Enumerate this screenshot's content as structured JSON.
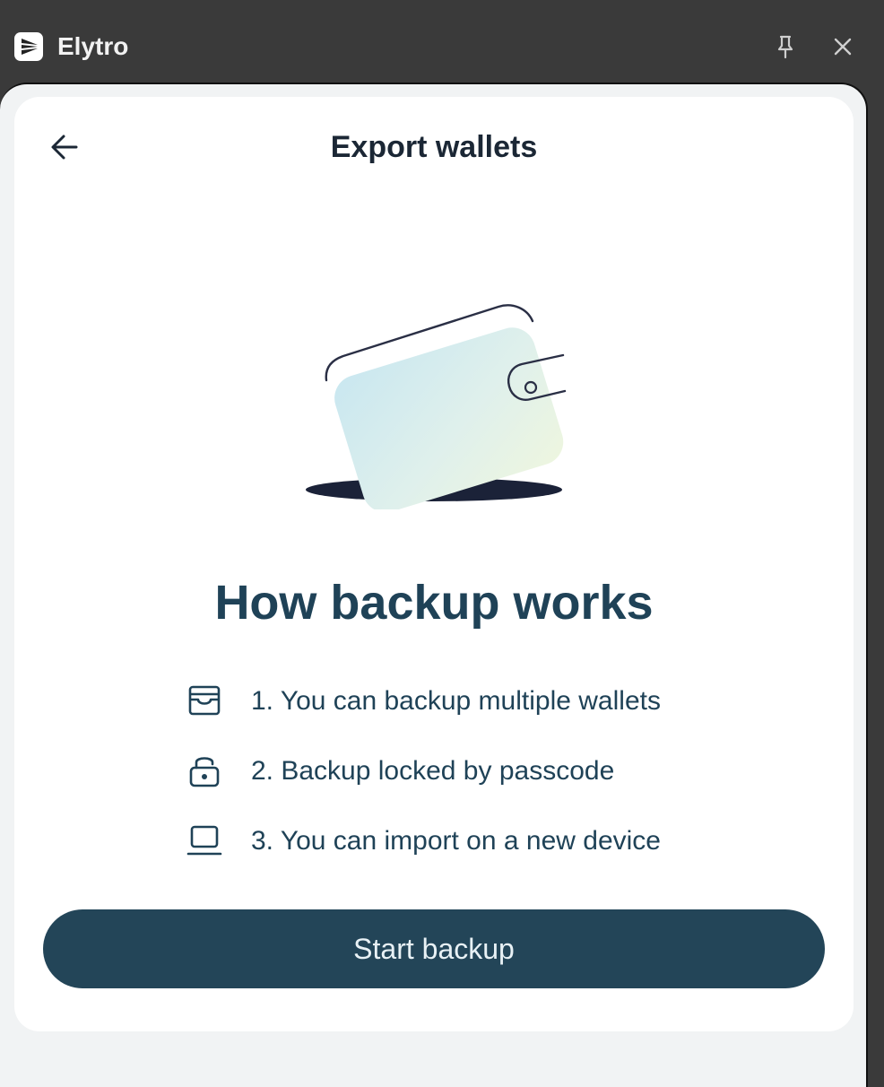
{
  "window": {
    "app_name": "Elytro",
    "logo_icon": "elytro-logo-icon",
    "pin_icon": "pin-icon",
    "close_icon": "close-icon"
  },
  "header": {
    "back_icon": "arrow-left-icon",
    "title": "Export wallets"
  },
  "main": {
    "illustration": "wallet-illustration",
    "heading": "How backup works",
    "features": [
      {
        "icon": "wallet-icon",
        "text": "1. You can backup multiple wallets"
      },
      {
        "icon": "lock-icon",
        "text": "2. Backup locked by passcode"
      },
      {
        "icon": "laptop-icon",
        "text": "3. You can import on a new device"
      }
    ],
    "start_button_label": "Start backup"
  },
  "colors": {
    "titlebar": "#3a3a3a",
    "panel_bg": "#f1f3f4",
    "card_bg": "#ffffff",
    "heading": "#1f4257",
    "button": "#234558",
    "button_text": "#e8f1f5"
  }
}
